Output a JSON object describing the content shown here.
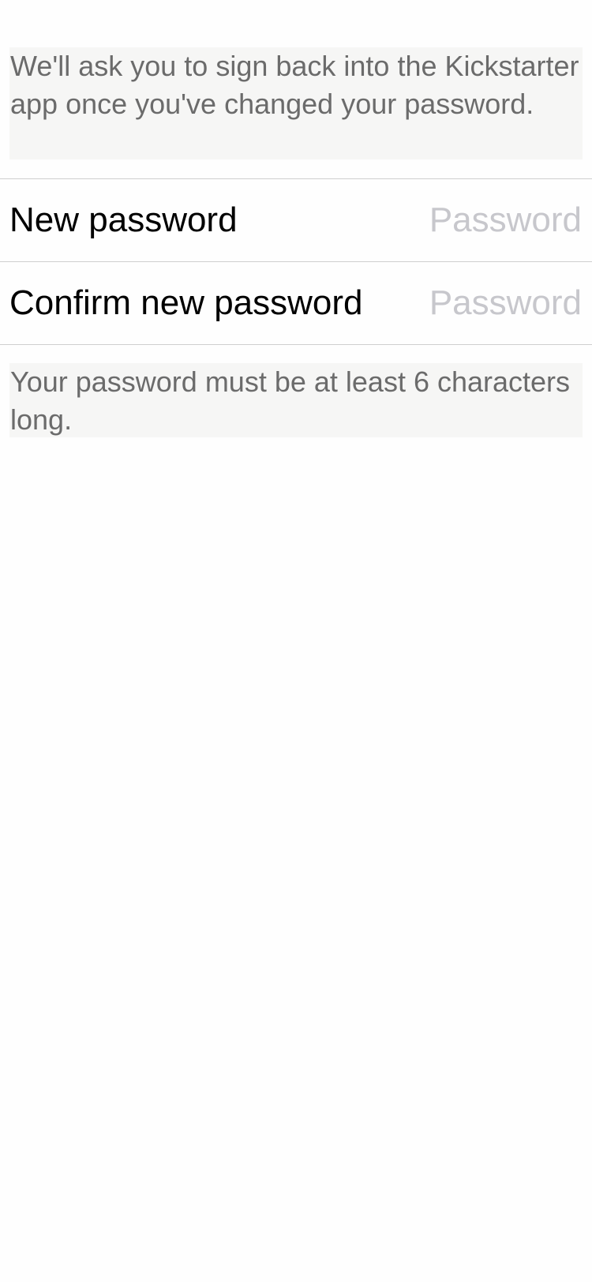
{
  "change_password": {
    "top_note": "We'll ask you to sign back into the Kickstarter app once you've changed your password.",
    "fields": [
      {
        "label": "New password",
        "value": "",
        "placeholder": "Password"
      },
      {
        "label": "Confirm new password",
        "value": "",
        "placeholder": "Password"
      }
    ],
    "bottom_note": "Your password must be at least 6 characters long."
  },
  "colors": {
    "background": "#fefefe",
    "note_background": "#f6f6f5",
    "note_text": "#6b6b6b",
    "label_text": "#000000",
    "placeholder_text": "#c7c7cc",
    "divider": "#cfcfcf"
  }
}
